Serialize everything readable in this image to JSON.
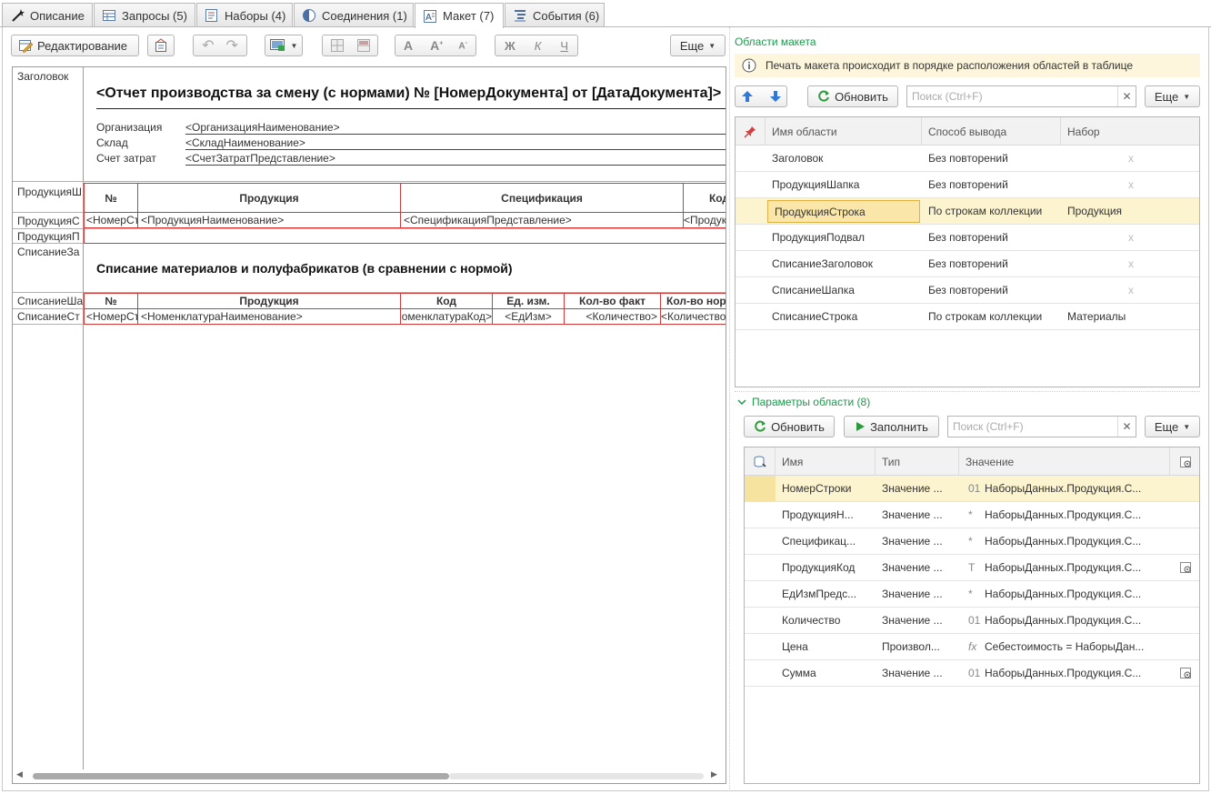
{
  "tabs": [
    {
      "label": "Описание",
      "icon": "wand-icon"
    },
    {
      "label": "Запросы (5)",
      "icon": "table-icon"
    },
    {
      "label": "Наборы (4)",
      "icon": "dataset-icon"
    },
    {
      "label": "Соединения (1)",
      "icon": "half-circle-icon"
    },
    {
      "label": "Макет (7)",
      "icon": "layout-icon"
    },
    {
      "label": "События (6)",
      "icon": "events-icon"
    }
  ],
  "toolbar": {
    "edit_label": "Редактирование",
    "more_label": "Еще",
    "bold_label": "Ж",
    "italic_label": "К",
    "underline_label": "Ч",
    "font_label": "A"
  },
  "sheet": {
    "row_names": [
      "Заголовок",
      "ПродукцияШ",
      "ПродукцияС",
      "ПродукцияП",
      "СписаниеЗа",
      "СписаниеШа",
      "СписаниеСт"
    ],
    "title": "<Отчет производства за смену (с нормами) № [НомерДокумента] от [ДатаДокумента]>",
    "fields": [
      {
        "label": "Организация",
        "value": "<ОрганизацияНаименование>"
      },
      {
        "label": "Склад",
        "value": "<СкладНаименование>"
      },
      {
        "label": "Счет затрат",
        "value": "<СчетЗатратПредставление>"
      }
    ],
    "prod_headers": [
      "№",
      "Продукция",
      "Спецификация",
      "Код"
    ],
    "prod_row": [
      "<НомерСтроки>",
      "<ПродукцияНаименование>",
      "<СпецификацияПредставление>",
      "<ПродукцияКод>"
    ],
    "write_off_title": "Списание материалов и полуфабрикатов (в сравнении с нормой)",
    "wo_headers": [
      "№",
      "Продукция",
      "Код",
      "Ед. изм.",
      "Кол-во факт",
      "Кол-во норма"
    ],
    "wo_row": [
      "<НомерСтроки>",
      "<НоменклатураНаименование>",
      "<НоменклатураКод>",
      "<ЕдИзм>",
      "<Количество>",
      "<КоличествоНорма>"
    ]
  },
  "areas": {
    "title": "Области макета",
    "info": "Печать макета происходит в порядке расположения областей в таблице",
    "refresh_label": "Обновить",
    "search_placeholder": "Поиск (Ctrl+F)",
    "more_label": "Еще",
    "columns": [
      "Имя области",
      "Способ вывода",
      "Набор"
    ],
    "rows": [
      {
        "name": "Заголовок",
        "mode": "Без повторений",
        "set": "x"
      },
      {
        "name": "ПродукцияШапка",
        "mode": "Без повторений",
        "set": "x"
      },
      {
        "name": "ПродукцияСтрока",
        "mode": "По строкам коллекции",
        "set": "Продукция"
      },
      {
        "name": "ПродукцияПодвал",
        "mode": "Без повторений",
        "set": "x"
      },
      {
        "name": "СписаниеЗаголовок",
        "mode": "Без повторений",
        "set": "x"
      },
      {
        "name": "СписаниеШапка",
        "mode": "Без повторений",
        "set": "x"
      },
      {
        "name": "СписаниеСтрока",
        "mode": "По строкам коллекции",
        "set": "Материалы"
      }
    ]
  },
  "params": {
    "title": "Параметры области (8)",
    "refresh_label": "Обновить",
    "fill_label": "Заполнить",
    "search_placeholder": "Поиск (Ctrl+F)",
    "more_label": "Еще",
    "columns": [
      "Имя",
      "Тип",
      "Значение"
    ],
    "rows": [
      {
        "name": "НомерСтроки",
        "type": "Значение ...",
        "vicon": "01",
        "value": "НаборыДанных.Продукция.С..."
      },
      {
        "name": "ПродукцияН...",
        "type": "Значение ...",
        "vicon": "*",
        "value": "НаборыДанных.Продукция.С..."
      },
      {
        "name": "Спецификац...",
        "type": "Значение ...",
        "vicon": "*",
        "value": "НаборыДанных.Продукция.С..."
      },
      {
        "name": "ПродукцияКод",
        "type": "Значение ...",
        "vicon": "T",
        "value": "НаборыДанных.Продукция.С..."
      },
      {
        "name": "ЕдИзмПредс...",
        "type": "Значение ...",
        "vicon": "*",
        "value": "НаборыДанных.Продукция.С..."
      },
      {
        "name": "Количество",
        "type": "Значение ...",
        "vicon": "01",
        "value": "НаборыДанных.Продукция.С..."
      },
      {
        "name": "Цена",
        "type": "Произвол...",
        "vicon": "fx",
        "value": "Себестоимость = НаборыДан..."
      },
      {
        "name": "Сумма",
        "type": "Значение ...",
        "vicon": "01",
        "value": "НаборыДанных.Продукция.С..."
      }
    ]
  }
}
